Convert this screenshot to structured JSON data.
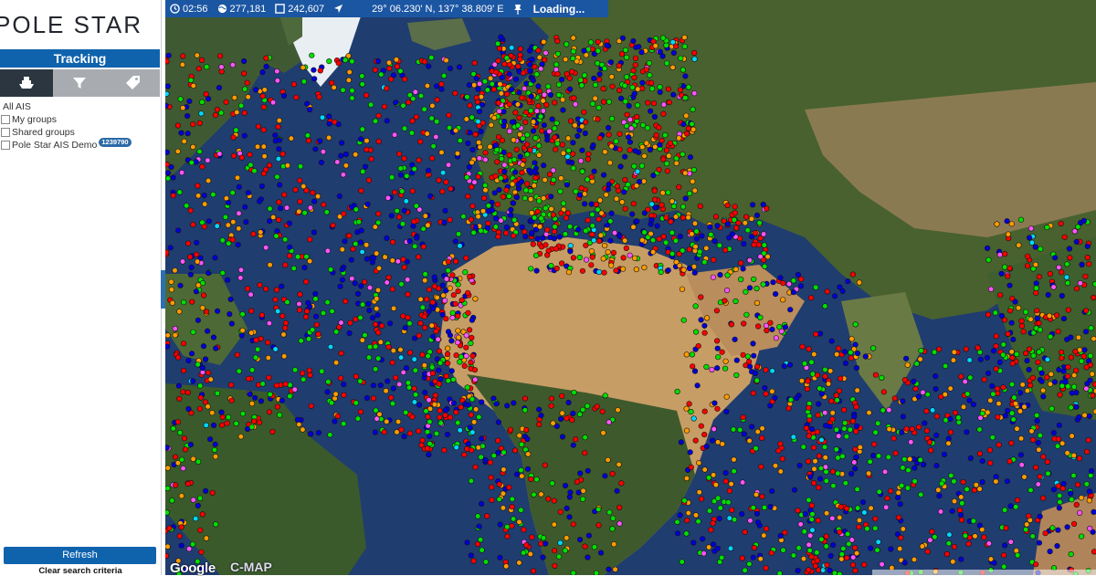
{
  "logo": {
    "text": "POLE STAR"
  },
  "sidebar": {
    "header": "Tracking",
    "tabs": [
      {
        "icon": "ship-icon",
        "active": true
      },
      {
        "icon": "filter-icon",
        "active": false
      },
      {
        "icon": "tag-icon",
        "active": false
      }
    ],
    "tree": {
      "root_label": "All AIS",
      "items": [
        {
          "label": "My groups",
          "checked": false
        },
        {
          "label": "Shared groups",
          "checked": false
        },
        {
          "label": "Pole Star AIS Demo",
          "checked": false,
          "badge": "1239790"
        }
      ]
    },
    "refresh_label": "Refresh",
    "clear_label": "Clear search criteria"
  },
  "statusbar": {
    "time": "02:56",
    "vessel_count": "277,181",
    "visible_count": "242,607",
    "coordinates": "29° 06.230' N, 137° 38.809' E",
    "loading": "Loading..."
  },
  "map": {
    "provider": "Google",
    "overlay_brand": "C-MAP",
    "marker_colors": [
      "#ff0000",
      "#0000d8",
      "#00e000",
      "#ff9c00",
      "#ff55ff",
      "#00d8ff"
    ],
    "land_color": "#3d5a2a",
    "desert_color": "#c9a06a",
    "ocean_color": "#1f3c6a"
  }
}
